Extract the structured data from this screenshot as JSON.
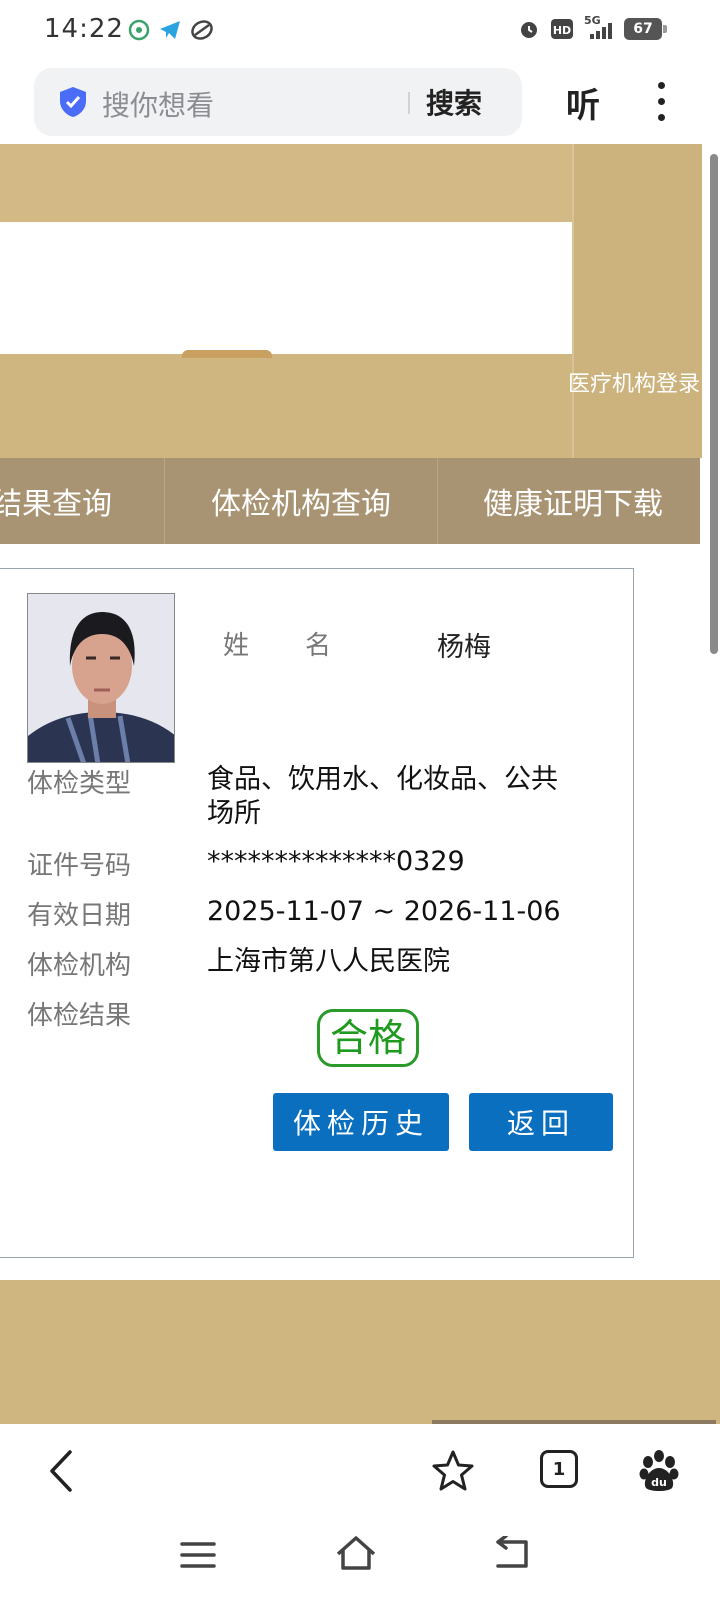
{
  "status_bar": {
    "time": "14:22",
    "network": "5G",
    "battery": "67",
    "icons": [
      "app-notification-icon",
      "telegram-icon",
      "sync-icon",
      "alarm-icon",
      "hd-icon",
      "signal-icon",
      "battery-icon"
    ]
  },
  "browser": {
    "search_placeholder": "搜你想看",
    "search_button": "搜索",
    "listen_button": "听"
  },
  "page": {
    "login_link": "医疗机构登录",
    "nav": [
      "结果查询",
      "体检机构查询",
      "健康证明下载"
    ],
    "record": {
      "name_label": "姓名",
      "name": "杨梅",
      "type_label": "体检类型",
      "type": "食品、饮用水、化妆品、公共场所",
      "id_label": "证件号码",
      "id": "**************0329",
      "valid_label": "有效日期",
      "valid": "2025-11-07 ~ 2026-11-06",
      "org_label": "体检机构",
      "org": "上海市第八人民医院",
      "result_label": "体检结果",
      "result": "合格"
    },
    "buttons": {
      "history": "体检历史",
      "back": "返回"
    }
  },
  "toolbar": {
    "tab_count": "1"
  },
  "colors": {
    "gold": "#cfb580",
    "nav_bar": "#a89373",
    "button_blue": "#0b6fbf",
    "pass_green": "#1e9a1e",
    "shield_blue": "#4a6cf7"
  }
}
